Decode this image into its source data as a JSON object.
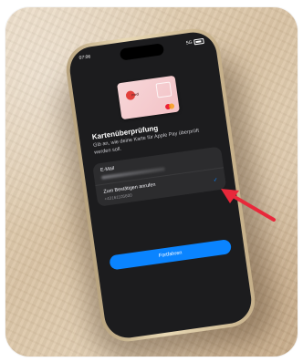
{
  "status_bar": {
    "time": "07:06",
    "right": "5G"
  },
  "card": {
    "logo_text": "nwd"
  },
  "page": {
    "title": "Kartenüberprüfung",
    "subtitle": "Gib an, wie deine Karte für Apple Pay überprüft werden soll."
  },
  "options": [
    {
      "label": "E-Mail",
      "detail": ""
    },
    {
      "label": "Zum Bestätigen anrufen",
      "detail": "+43161105600",
      "selected": true
    }
  ],
  "button": {
    "label": "Fortfahren"
  },
  "colors": {
    "accent": "#0a84ff",
    "arrow": "#e8283a",
    "screen": "#1c1c1e"
  }
}
